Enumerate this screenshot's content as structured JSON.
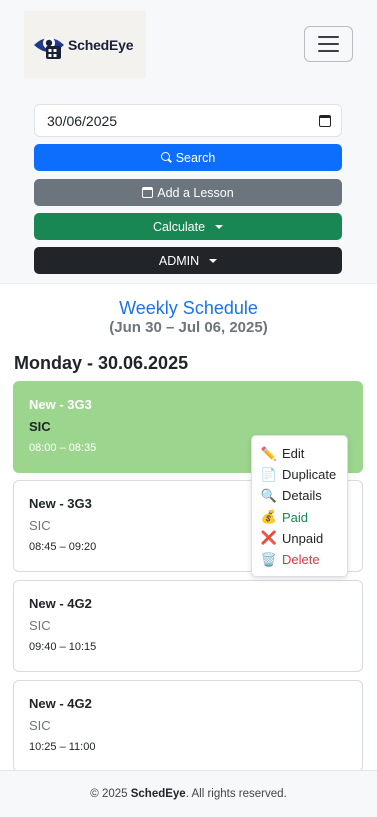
{
  "brand": {
    "name": "SchedEye"
  },
  "toolbar": {
    "date_value": "30/06/2025",
    "search_label": "Search",
    "add_lesson_label": "Add a Lesson",
    "calculate_label": "Calculate",
    "admin_label": "ADMIN"
  },
  "schedule": {
    "title": "Weekly Schedule",
    "range": "(Jun 30 – Jul 06, 2025)",
    "day_heading": "Monday - 30.06.2025",
    "lessons": [
      {
        "name": "New - 3G3",
        "subject": "SIC",
        "time": "08:00 – 08:35"
      },
      {
        "name": "New - 3G3",
        "subject": "SIC",
        "time": "08:45 – 09:20"
      },
      {
        "name": "New - 4G2",
        "subject": "SIC",
        "time": "09:40 – 10:15"
      },
      {
        "name": "New - 4G2",
        "subject": "SIC",
        "time": "10:25 – 11:00"
      }
    ]
  },
  "context_menu": {
    "items": [
      {
        "label": "Edit",
        "icon": "pencil-icon"
      },
      {
        "label": "Duplicate",
        "icon": "document-icon"
      },
      {
        "label": "Details",
        "icon": "magnifier-icon"
      },
      {
        "label": "Paid",
        "icon": "money-bag-icon"
      },
      {
        "label": "Unpaid",
        "icon": "cross-mark-icon"
      },
      {
        "label": "Delete",
        "icon": "trash-icon"
      }
    ]
  },
  "footer": {
    "prefix": "© 2025 ",
    "brand": "SchedEye",
    "suffix": ". All rights reserved."
  }
}
